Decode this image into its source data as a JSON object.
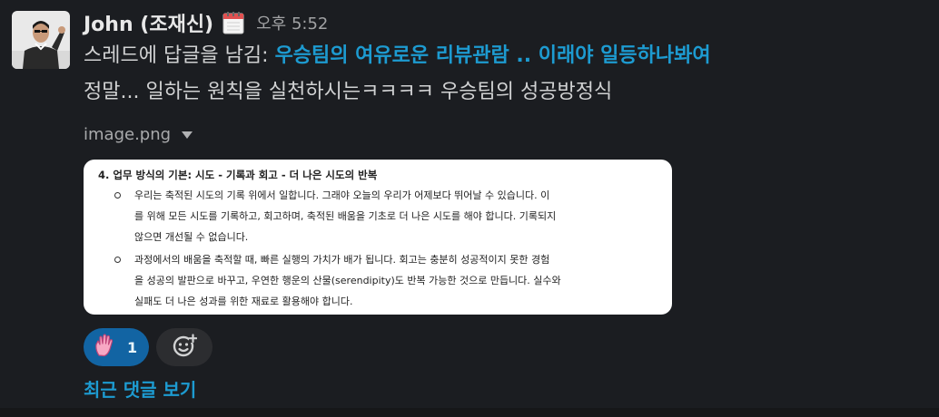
{
  "message": {
    "author": "John (조재신)",
    "status_icon": "calendar-icon",
    "time": "오후 5:52",
    "reply_prefix": "스레드에 답글을 남김: ",
    "thread_link": "우승팀의 여유로운 리뷰관람 .. 이래야 일등하나봐여",
    "body": "정말... 일하는 원칙을 실천하시는ㅋㅋㅋㅋ 우승팀의 성공방정식"
  },
  "attachment": {
    "filename": "image.png",
    "doc": {
      "title": "4. 업무 방식의 기본: 시도 - 기록과 회고 - 더 나은 시도의 반복",
      "bullets": [
        {
          "lines": [
            "우리는 축적된 시도의 기록 위에서 일합니다. 그래야 오늘의 우리가 어제보다 뛰어날 수 있습니다. 이",
            "를 위해 모든 시도를 기록하고, 회고하며, 축적된 배움을 기초로 더 나은 시도를 해야 합니다. 기록되지",
            "않으면 개선될 수 없습니다."
          ]
        },
        {
          "lines": [
            "과정에서의 배움을 축적할 때, 빠른 실행의 가치가 배가 됩니다. 회고는 충분히 성공적이지 못한 경험",
            "을 성공의 발판으로 바꾸고, 우연한 행운의 산물(serendipity)도 반복 가능한 것으로 만듭니다. 실수와",
            "실패도 더 나은 성과를 위한 재료로 활용해야 합니다."
          ]
        }
      ]
    }
  },
  "reactions": [
    {
      "icon": "raised-hand-icon",
      "count": "1"
    }
  ],
  "add_reaction_icon": "add-emoji-icon",
  "replies_link": "최근 댓글 보기",
  "colors": {
    "background": "#1b1d21",
    "link": "#1d9bd1",
    "reaction_bg": "#1264a3"
  }
}
